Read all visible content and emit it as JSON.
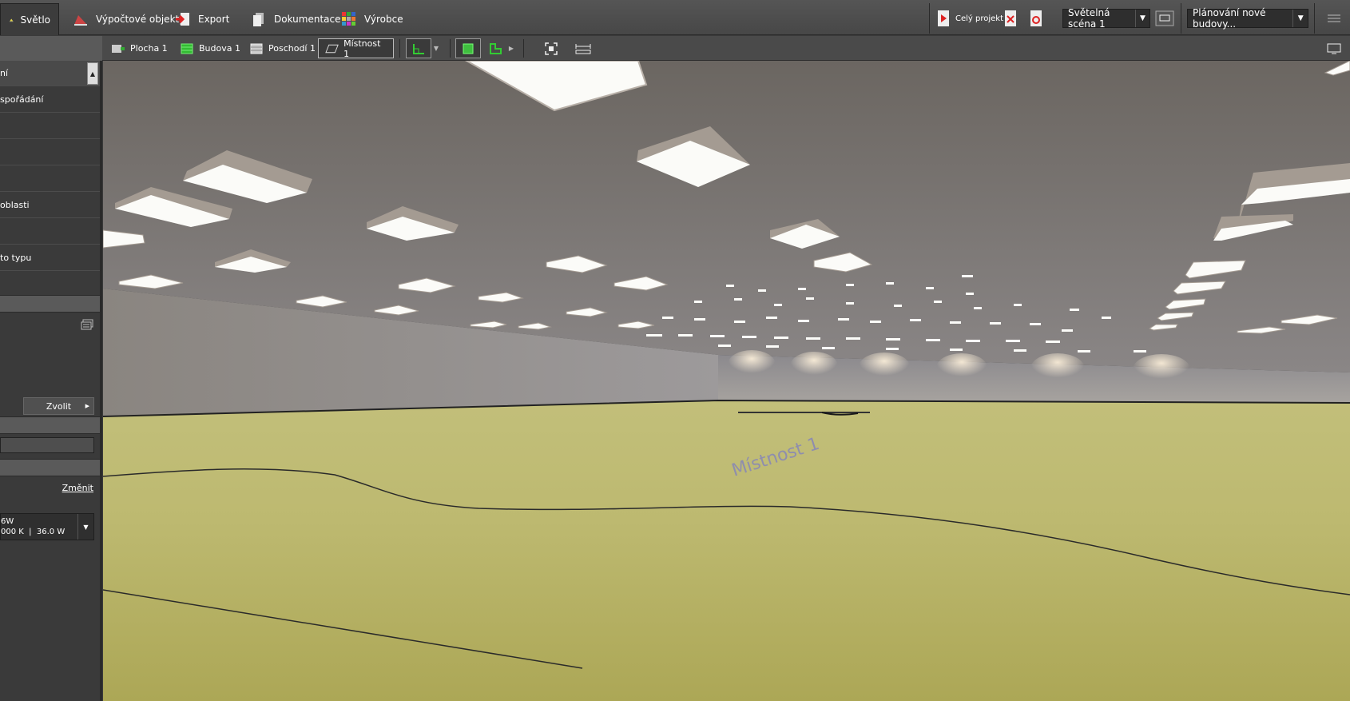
{
  "ribbon": {
    "tabs": [
      {
        "label": "Světlo",
        "icon": "lamp-icon"
      },
      {
        "label": "Výpočtové objekty",
        "icon": "calculation-objects-icon"
      },
      {
        "label": "Export",
        "icon": "export-icon"
      },
      {
        "label": "Dokumentace",
        "icon": "documentation-icon"
      },
      {
        "label": "Výrobce",
        "icon": "manufacturer-icon"
      }
    ],
    "whole_project_label": "Celý projekt",
    "light_scene": "Světelná scéna 1",
    "planning": "Plánování nové budovy..."
  },
  "breadcrumbs": [
    {
      "label": "Plocha 1",
      "icon": "site-icon"
    },
    {
      "label": "Budova 1",
      "icon": "building-icon"
    },
    {
      "label": "Poschodí 1",
      "icon": "floor-icon"
    },
    {
      "label": "Místnost 1",
      "icon": "room-icon"
    }
  ],
  "sidebar": {
    "items": [
      "ní",
      "spořádání",
      "",
      "",
      "",
      "oblasti",
      "",
      "to typu",
      ""
    ],
    "choose_button": "Zvolit",
    "change_link": "Změnit",
    "luminaire_line1": "6W",
    "luminaire_line2": "000 K  |  36.0 W"
  },
  "viewport": {
    "room_label": "Místnost 1"
  },
  "colors": {
    "ceiling": "#6f6a66",
    "wall": "#8c8886",
    "floor": "#b5b163",
    "accent_green": "#3fbf3f"
  }
}
